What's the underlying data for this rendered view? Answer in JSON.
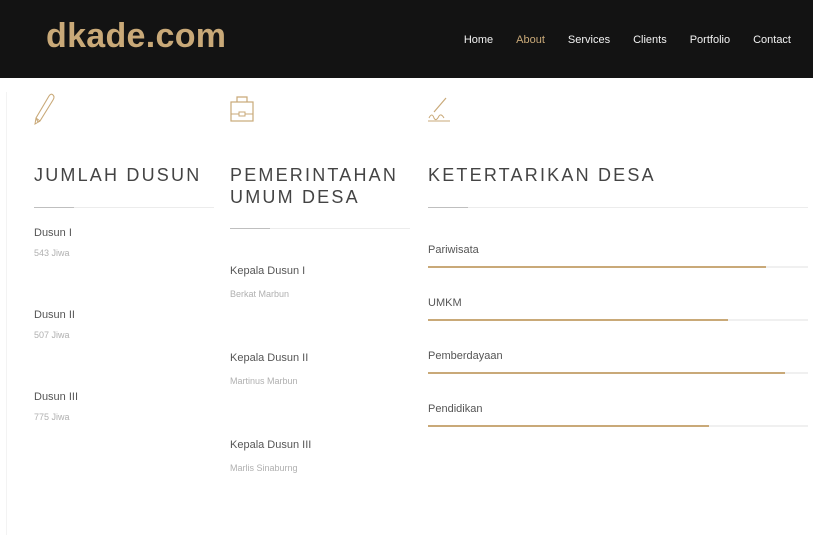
{
  "brand": "dkade.com",
  "nav": [
    "Home",
    "About",
    "Services",
    "Clients",
    "Portfolio",
    "Contact"
  ],
  "active_nav": "About",
  "accent_color": "#c9a978",
  "navbar_color": "#131313",
  "columns": {
    "dusun": {
      "icon": "pencil-icon",
      "heading": "JUMLAH DUSUN",
      "items": [
        {
          "title": "Dusun I",
          "sub": "543 Jiwa"
        },
        {
          "title": "Dusun II",
          "sub": "507 Jiwa"
        },
        {
          "title": "Dusun III",
          "sub": "775 Jiwa"
        }
      ]
    },
    "pemerintahan": {
      "icon": "briefcase-icon",
      "heading_line1": "PEMERINTAHAN",
      "heading_line2": "UMUM DESA",
      "items": [
        {
          "title": "Kepala Dusun I",
          "sub": "Berkat Marbun"
        },
        {
          "title": "Kepala Dusun II",
          "sub": "Martinus Marbun"
        },
        {
          "title": "Kepala Dusun III",
          "sub": "Marlis Sinaburng"
        }
      ]
    },
    "ketertarikan": {
      "icon": "signature-icon",
      "heading": "KETERTARIKAN DESA",
      "skills": [
        {
          "name": "Pariwisata",
          "level": 0.89
        },
        {
          "name": "UMKM",
          "level": 0.79
        },
        {
          "name": "Pemberdayaan",
          "level": 0.94
        },
        {
          "name": "Pendidikan",
          "level": 0.74
        }
      ]
    }
  }
}
